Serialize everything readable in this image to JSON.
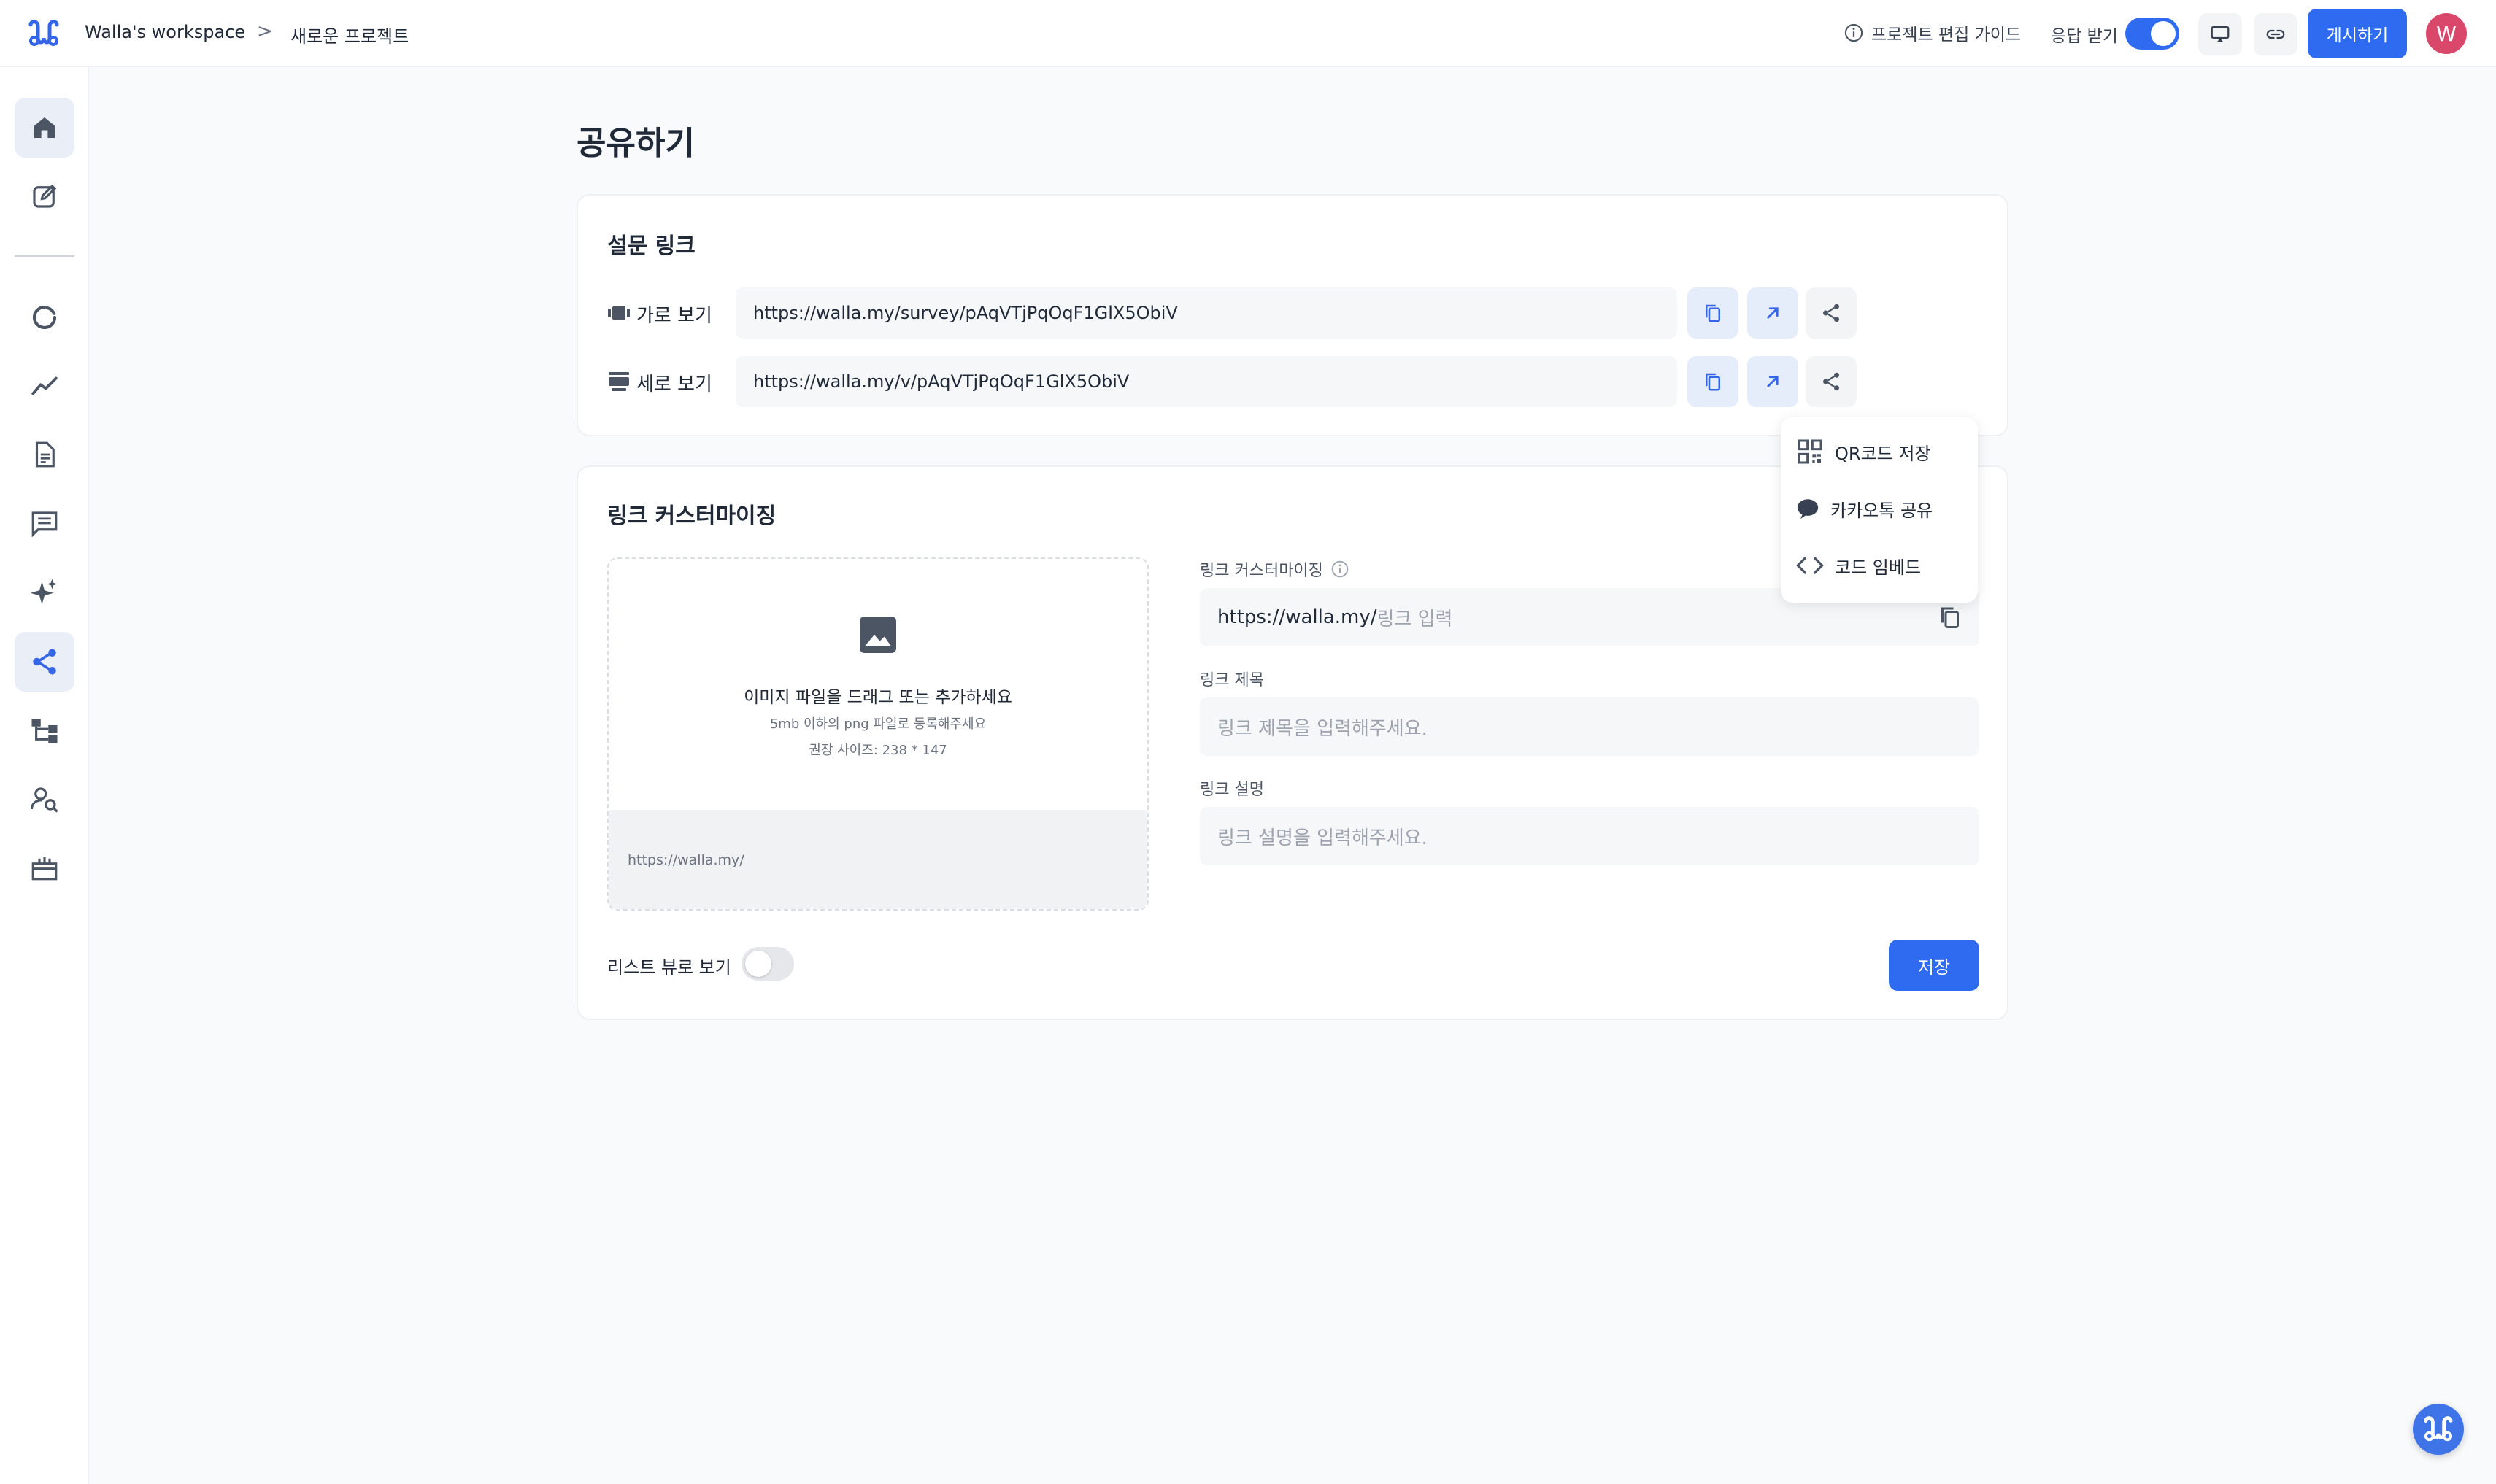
{
  "colors": {
    "accent": "#2f6bf0",
    "avatar": "#d9476b",
    "sidebar_icon": "#4b5563"
  },
  "header": {
    "workspace": "Walla's workspace",
    "separator": ">",
    "project": "새로운 프로젝트",
    "guide": "프로젝트 편집 가이드",
    "responses_label": "응답 받기",
    "publish": "게시하기",
    "avatar_initial": "W",
    "icons": [
      "monitor-icon",
      "link-icon"
    ]
  },
  "sidebar": {
    "items": [
      {
        "name": "home-icon"
      },
      {
        "name": "edit-icon"
      },
      {
        "name": "refresh-icon"
      },
      {
        "name": "analytics-icon"
      },
      {
        "name": "document-icon"
      },
      {
        "name": "comments-icon"
      },
      {
        "name": "sparkle-icon"
      },
      {
        "name": "share-icon",
        "active": true
      },
      {
        "name": "flow-icon"
      },
      {
        "name": "user-search-icon"
      },
      {
        "name": "gift-icon"
      }
    ]
  },
  "main": {
    "title": "공유하기",
    "survey_link": {
      "title": "설문 링크",
      "rows": [
        {
          "label": "가로 보기",
          "url": "https://walla.my/survey/pAqVTjPqOqF1GlX5ObiV"
        },
        {
          "label": "세로 보기",
          "url": "https://walla.my/v/pAqVTjPqOqF1GlX5ObiV"
        }
      ]
    },
    "dropdown": {
      "items": [
        "QR코드 저장",
        "카카오톡 공유",
        "코드 임베드"
      ]
    },
    "customize": {
      "title": "링크 커스터마이징",
      "upload": {
        "line1": "이미지 파일을 드래그 또는 추가하세요",
        "line2": "5mb 이하의 png 파일로 등록해주세요",
        "line3": "권장 사이즈: 238 * 147",
        "footer_url": "https://walla.my/"
      },
      "custom_label": "링크 커스터마이징",
      "custom_prefix": "https://walla.my/",
      "custom_placeholder": "링크 입력",
      "title_label": "링크 제목",
      "title_placeholder": "링크 제목을 입력해주세요.",
      "desc_label": "링크 설명",
      "desc_placeholder": "링크 설명을 입력해주세요.",
      "list_view_label": "리스트 뷰로 보기",
      "list_view_on": false,
      "save": "저장"
    }
  }
}
